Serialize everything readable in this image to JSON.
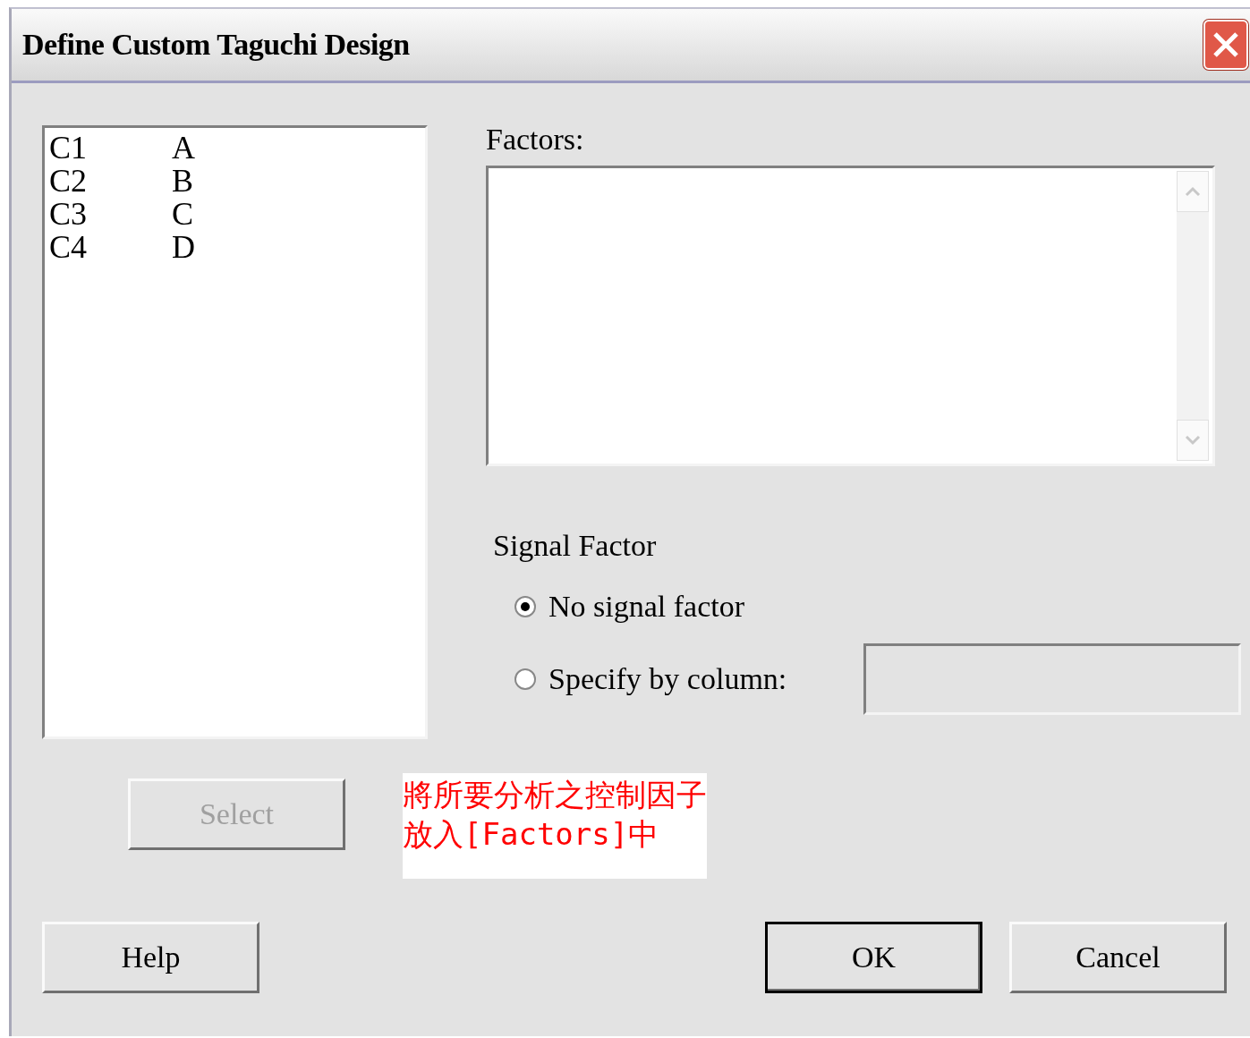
{
  "window": {
    "title": "Define Custom Taguchi Design"
  },
  "columns_list": [
    {
      "column": "C1",
      "name": "A"
    },
    {
      "column": "C2",
      "name": "B"
    },
    {
      "column": "C3",
      "name": "C"
    },
    {
      "column": "C4",
      "name": "D"
    }
  ],
  "factors": {
    "label": "Factors:"
  },
  "signal_factor": {
    "label": "Signal Factor",
    "options": [
      {
        "label": "No signal factor",
        "selected": true
      },
      {
        "label": "Specify by column:",
        "selected": false
      }
    ]
  },
  "select_button": {
    "label": "Select",
    "disabled": true
  },
  "annotation": {
    "lines": [
      "將所要分析之控制因子",
      "放入[Factors]中"
    ]
  },
  "buttons": [
    {
      "label": "Help",
      "default": false
    },
    {
      "label": "OK",
      "default": true
    },
    {
      "label": "Cancel",
      "default": false
    }
  ]
}
